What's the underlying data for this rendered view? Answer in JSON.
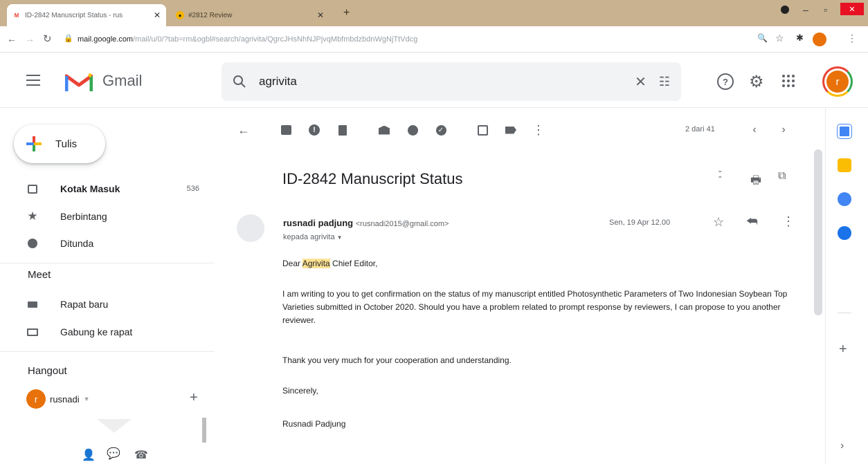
{
  "browser": {
    "tabs": [
      {
        "title": "ID-2842 Manuscript Status - rus"
      },
      {
        "title": "#2812 Review"
      }
    ],
    "url_host": "mail.google.com",
    "url_path": "/mail/u/0/?tab=rm&ogbl#search/agrivita/QgrcJHsNhNJPjvqMbfmbdzbdnWgNjTtVdcg"
  },
  "gmail": {
    "app_name": "Gmail",
    "search_query": "agrivita",
    "avatar_letter": "r"
  },
  "sidebar": {
    "compose_label": "Tulis",
    "items": [
      {
        "label": "Kotak Masuk",
        "count": "536"
      },
      {
        "label": "Berbintang"
      },
      {
        "label": "Ditunda"
      }
    ],
    "meet_heading": "Meet",
    "meet_items": [
      {
        "label": "Rapat baru"
      },
      {
        "label": "Gabung ke rapat"
      }
    ],
    "hangout_heading": "Hangout",
    "hangout_user": "rusnadi",
    "hangout_avatar": "r"
  },
  "toolbar": {
    "pagination": "2 dari 41"
  },
  "message": {
    "subject": "ID-2842 Manuscript Status",
    "sender_name": "rusnadi padjung",
    "sender_email": "<rusnadi2015@gmail.com>",
    "recipient": "kepada agrivita",
    "date": "Sen, 19 Apr 12.00",
    "greeting_pre": "Dear ",
    "greeting_highlight": "Agrivita",
    "greeting_post": " Chief Editor,",
    "paragraph1": "I am writing to you to get confirmation on the status of my manuscript entitled Photosynthetic Parameters of Two Indonesian Soybean Top Varieties submitted in October 2020. Should you have a problem related to prompt response by reviewers,  I can propose to you another reviewer.",
    "paragraph2": "Thank you very much  for your cooperation and understanding.",
    "closing": "Sincerely,",
    "signature": "Rusnadi Padjung"
  },
  "colors": {
    "chrome_tab_bar": "#c8b28f",
    "avatar": "#e8710a",
    "highlight": "#fde293",
    "gmail_red": "#ea4335"
  }
}
